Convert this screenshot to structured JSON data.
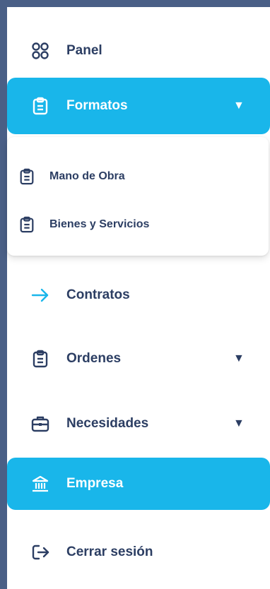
{
  "sidebar": {
    "items": [
      {
        "label": "Panel",
        "icon": "grid-icon"
      },
      {
        "label": "Formatos",
        "icon": "clipboard-icon",
        "chevron": "▼"
      },
      {
        "label": "Contratos",
        "icon": "arrow-right-icon"
      },
      {
        "label": "Ordenes",
        "icon": "clipboard-icon",
        "chevron": "▼"
      },
      {
        "label": "Necesidades",
        "icon": "briefcase-icon",
        "chevron": "▼"
      },
      {
        "label": "Empresa",
        "icon": "bank-icon"
      },
      {
        "label": "Cerrar sesión",
        "icon": "logout-icon"
      }
    ],
    "submenu": [
      {
        "label": "Mano de Obra",
        "icon": "clipboard-icon"
      },
      {
        "label": "Bienes y Servicios",
        "icon": "clipboard-icon"
      }
    ]
  },
  "colors": {
    "background": "#4a5f86",
    "accent": "#19b6ea",
    "text": "#2c3e63"
  }
}
